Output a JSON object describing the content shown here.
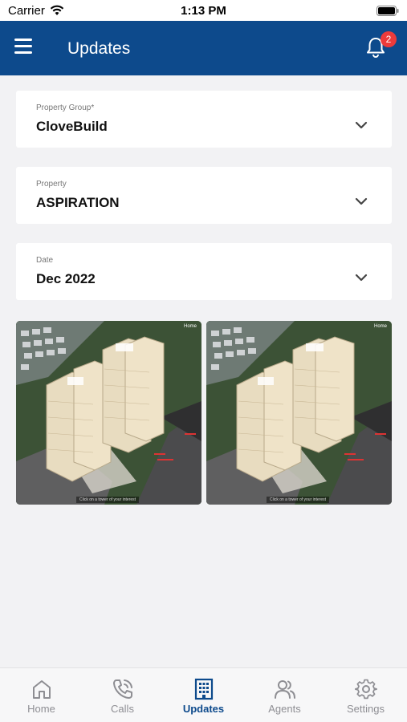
{
  "status_bar": {
    "carrier": "Carrier",
    "time": "1:13 PM"
  },
  "header": {
    "title": "Updates",
    "notification_count": "2"
  },
  "filters": [
    {
      "label": "Property Group*",
      "value": "CloveBuild"
    },
    {
      "label": "Property",
      "value": "ASPIRATION"
    },
    {
      "label": "Date",
      "value": "Dec 2022"
    }
  ],
  "photos": [
    {
      "home_tag": "Home",
      "hint": "Click on a tower of your interest"
    },
    {
      "home_tag": "Home",
      "hint": "Click on a tower of your interest"
    }
  ],
  "tabs": [
    {
      "label": "Home",
      "icon": "home-icon"
    },
    {
      "label": "Calls",
      "icon": "phone-icon"
    },
    {
      "label": "Updates",
      "icon": "building-icon",
      "active": true
    },
    {
      "label": "Agents",
      "icon": "people-icon"
    },
    {
      "label": "Settings",
      "icon": "gear-icon"
    }
  ],
  "colors": {
    "primary": "#0d4a8c",
    "badge": "#ec3b3b",
    "inactive": "#8e8e93"
  }
}
